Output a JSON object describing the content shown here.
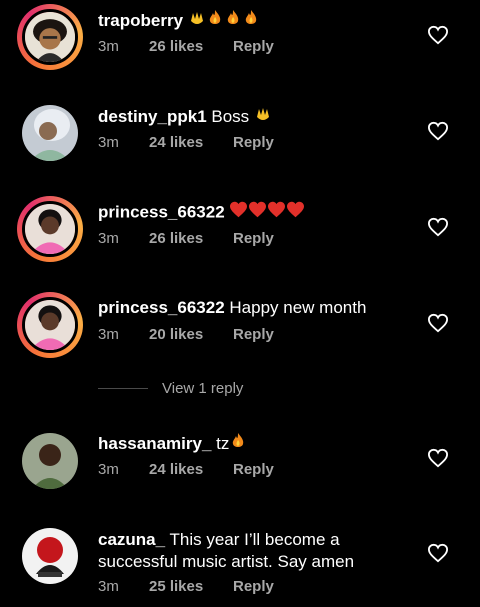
{
  "colors": {
    "background": "#000000",
    "text": "#ffffff",
    "meta": "#a8a8a8",
    "emoji_red": "#e2302a",
    "emoji_yellow": "#f6c026"
  },
  "comments": [
    {
      "username": "trapoberry",
      "text": "",
      "emoji": "raising-hands fire fire fire",
      "time": "3m",
      "likes": "26 likes",
      "reply": "Reply",
      "story_ring": true
    },
    {
      "username": "destiny_ppk1",
      "text": "Boss",
      "emoji": "raising-hands",
      "time": "3m",
      "likes": "24 likes",
      "reply": "Reply",
      "story_ring": false
    },
    {
      "username": "princess_66322",
      "text": "",
      "emoji": "red-heart x4",
      "time": "3m",
      "likes": "26 likes",
      "reply": "Reply",
      "story_ring": true
    },
    {
      "username": "princess_66322",
      "text": "Happy new month",
      "emoji": "",
      "time": "3m",
      "likes": "20 likes",
      "reply": "Reply",
      "story_ring": true
    },
    {
      "username": "hassanamiry_",
      "text": "tz",
      "emoji": "fire",
      "time": "3m",
      "likes": "24 likes",
      "reply": "Reply",
      "story_ring": false
    },
    {
      "username": "cazuna_",
      "text": "This year I’ll become a",
      "text_line2": "successful music artist. Say amen",
      "emoji": "",
      "time": "3m",
      "likes": "25 likes",
      "reply": "Reply",
      "story_ring": false
    }
  ],
  "view_replies": "View 1 reply"
}
